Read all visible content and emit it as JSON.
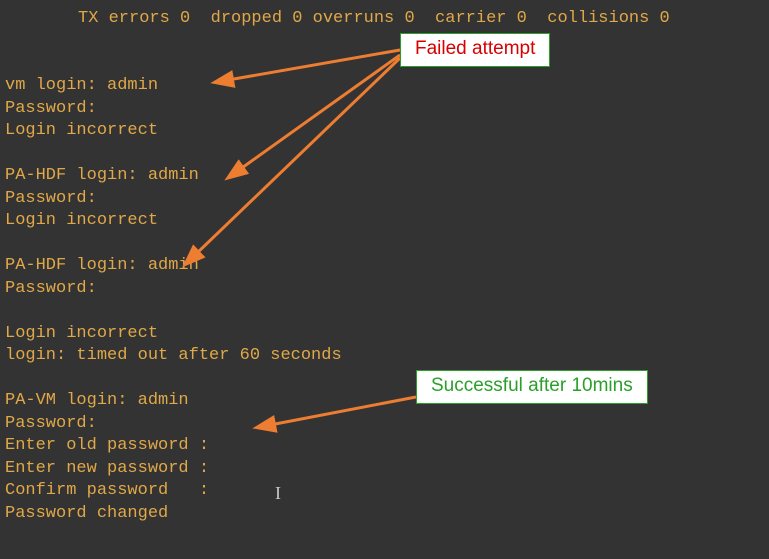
{
  "topLine": "TX errors 0  dropped 0 overruns 0  carrier 0  collisions 0",
  "terminalLines": [
    "vm login: admin",
    "Password:",
    "Login incorrect",
    "",
    "PA-HDF login: admin",
    "Password:",
    "Login incorrect",
    "",
    "PA-HDF login: admin",
    "Password:",
    "",
    "Login incorrect",
    "login: timed out after 60 seconds",
    "",
    "PA-VM login: admin",
    "Password:",
    "Enter old password :",
    "Enter new password :",
    "Confirm password   :",
    "Password changed"
  ],
  "callouts": {
    "failed": "Failed attempt",
    "success": "Successful after 10mins"
  },
  "arrowColor": "#ed7d31"
}
